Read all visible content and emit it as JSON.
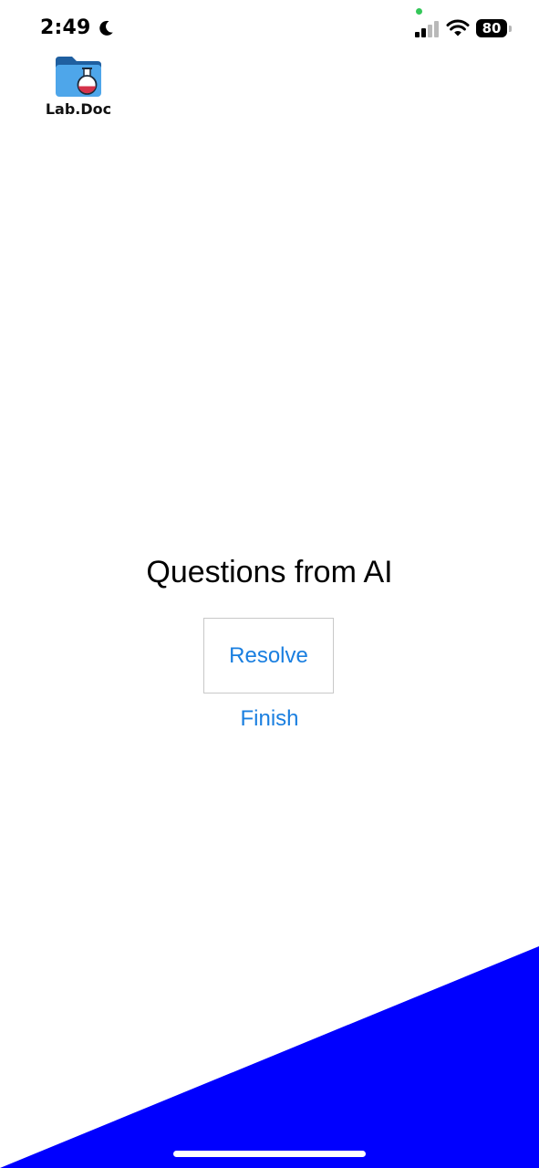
{
  "status_bar": {
    "time": "2:49",
    "battery_level": "80",
    "icons": [
      "moon-icon",
      "signal-icon",
      "wifi-icon",
      "battery-icon"
    ]
  },
  "logo": {
    "text": "Lab.Doc",
    "icon": "folder-flask-icon"
  },
  "main": {
    "heading": "Questions from AI",
    "resolve_label": "Resolve",
    "finish_label": "Finish"
  },
  "colors": {
    "accent": "#1a7fe0",
    "corner_shape": "#0000ff",
    "privacy_dot": "#34c759"
  }
}
